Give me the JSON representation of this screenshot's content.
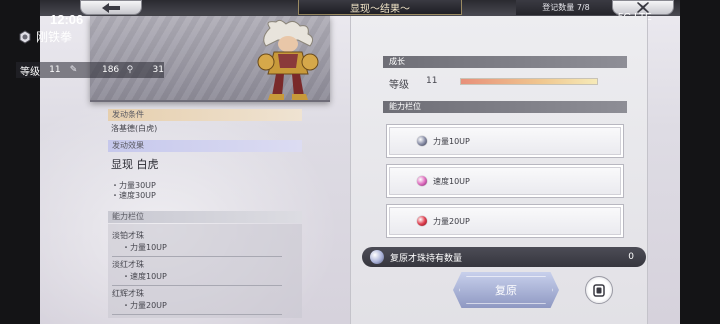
{
  "header": {
    "time": "12:06",
    "title": "显现～结果～",
    "registration": "登记数量 7/8",
    "status_text": "5G LTE"
  },
  "character": {
    "name": "刚铁拳",
    "level_label": "等级",
    "level": "11",
    "stat_attack": "186",
    "stat_skill": "31"
  },
  "left": {
    "trigger_title": "发动条件",
    "trigger_value": "洛基德(白虎)",
    "effect_title": "发动效果",
    "effect_name": "显现 白虎",
    "effect_lines": [
      "・力量30UP",
      "・速度30UP"
    ],
    "slots_title": "能力栏位",
    "slots": [
      {
        "name": "淡铂才珠",
        "effect": "・力量10UP"
      },
      {
        "name": "淡红才珠",
        "effect": "・速度10UP"
      },
      {
        "name": "红辉才珠",
        "effect": "・力量20UP"
      }
    ]
  },
  "right": {
    "growth_title": "成长",
    "level_label": "等级",
    "level": "11",
    "growth_fraction": 1.0,
    "slots_title": "能力栏位",
    "slot_buttons": [
      {
        "label": "力量10UP",
        "gem": "gray"
      },
      {
        "label": "速度10UP",
        "gem": "pink"
      },
      {
        "label": "力量20UP",
        "gem": "red"
      }
    ],
    "restore_label": "复原才珠持有数量",
    "restore_count": "0",
    "restore_button": "复原"
  },
  "colors": {
    "accent_gold": "#9a8a62",
    "panel_header": "#6e6e76",
    "trigger_head": "#e6cfae",
    "effect_head": "#c6c8ec"
  }
}
